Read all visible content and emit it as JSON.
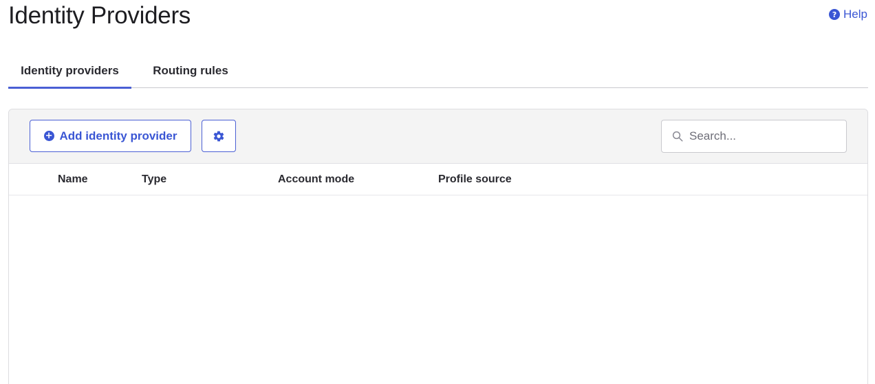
{
  "page": {
    "title": "Identity Providers",
    "help_label": "Help"
  },
  "tabs": [
    {
      "label": "Identity providers",
      "active": true
    },
    {
      "label": "Routing rules",
      "active": false
    }
  ],
  "toolbar": {
    "add_label": "Add identity provider",
    "search_placeholder": "Search..."
  },
  "table": {
    "columns": [
      "Name",
      "Type",
      "Account mode",
      "Profile source"
    ],
    "rows": []
  },
  "colors": {
    "accent": "#4a5fd4",
    "link": "#3a56d4",
    "toolbar_bg": "#f4f4f4"
  },
  "icons": {
    "help": "question-circle-icon",
    "add": "plus-circle-icon",
    "settings": "gear-icon",
    "search": "search-icon"
  }
}
